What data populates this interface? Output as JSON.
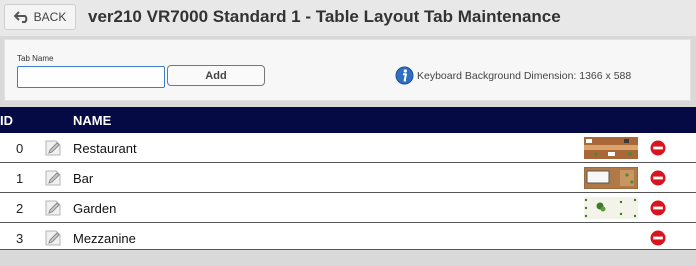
{
  "header": {
    "back_label": "BACK",
    "title": "ver210 VR7000 Standard 1 - Table Layout Tab Maintenance"
  },
  "form": {
    "tab_name_label": "Tab Name",
    "tab_name_value": "",
    "add_label": "Add",
    "info_text": "Keyboard Background Dimension: 1366 x 588"
  },
  "table": {
    "columns": [
      "ID",
      "NAME"
    ],
    "rows": [
      {
        "id": "0",
        "name": "Restaurant",
        "thumbnail": "restaurant-layout"
      },
      {
        "id": "1",
        "name": "Bar",
        "thumbnail": "bar-layout"
      },
      {
        "id": "2",
        "name": "Garden",
        "thumbnail": "garden-layout"
      },
      {
        "id": "3",
        "name": "Mezzanine",
        "thumbnail": ""
      }
    ]
  },
  "colors": {
    "header_bg": "#050a45",
    "delete_red": "#d9141e",
    "input_border": "#3c7fc8",
    "info_blue": "#2f6fc2"
  }
}
